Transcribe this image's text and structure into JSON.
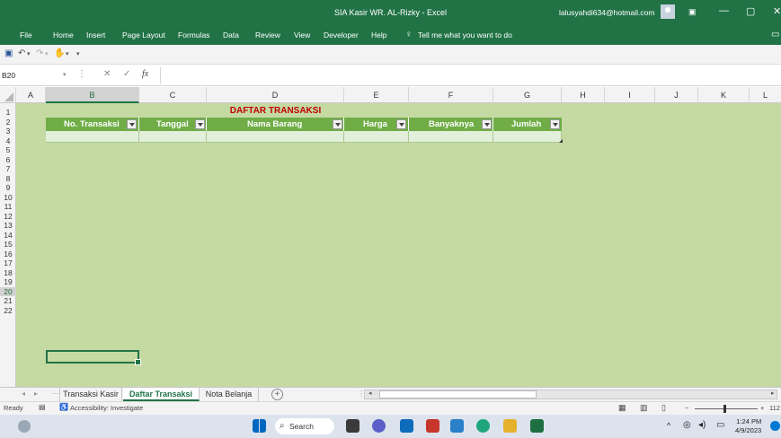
{
  "titlebar": {
    "title": "SIA Kasir WR. AL-Rizky  -  Excel",
    "account": "lalusyahdi634@hotmail.com",
    "minimize": "—",
    "restore": "▢",
    "close": "✕"
  },
  "ribbon_tabs": [
    "File",
    "Home",
    "Insert",
    "Page Layout",
    "Formulas",
    "Data",
    "Review",
    "View",
    "Developer",
    "Help"
  ],
  "tell_me": "Tell me what you want to do",
  "formula_bar": {
    "name_box": "B20",
    "cancel": "✕",
    "enter": "✓",
    "fx": "fx",
    "value": ""
  },
  "columns": [
    "A",
    "B",
    "C",
    "D",
    "E",
    "F",
    "G",
    "H",
    "I",
    "J",
    "K",
    "L"
  ],
  "selected_column": "B",
  "rows": [
    "1",
    "2",
    "3",
    "4",
    "5",
    "6",
    "7",
    "8",
    "9",
    "10",
    "11",
    "12",
    "13",
    "14",
    "15",
    "16",
    "17",
    "18",
    "19",
    "20",
    "21",
    "22"
  ],
  "selected_row": "20",
  "sheet_title": "DAFTAR TRANSAKSI",
  "table_headers": [
    "No. Transaksi",
    "Tanggal",
    "Nama Barang",
    "Harga",
    "Banyaknya",
    "Jumlah"
  ],
  "sheet_tabs": [
    {
      "label": "Transaksi Kasir",
      "active": false
    },
    {
      "label": "Daftar Transaksi",
      "active": true
    },
    {
      "label": "Nota Belanja",
      "active": false
    }
  ],
  "add_sheet": "+",
  "status": {
    "ready": "Ready",
    "accessibility": "Accessibility: Investigate",
    "zoom": "112"
  },
  "taskbar": {
    "search": "Search",
    "time": "1:24 PM",
    "date": "4/9/2023"
  },
  "colors": {
    "excel_green": "#217346",
    "grid_background": "#c5d9a3",
    "header_fill": "#70ad47",
    "title_red": "#c00000",
    "row_fill": "#e2efda"
  }
}
